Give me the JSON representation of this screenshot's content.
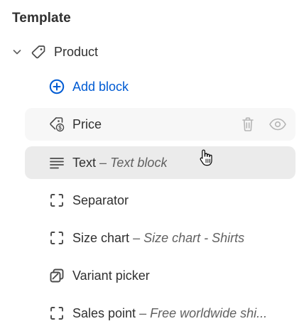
{
  "section": {
    "title": "Template"
  },
  "product": {
    "label": "Product",
    "icon": "tag-icon",
    "expanded": true
  },
  "add_block": {
    "label": "Add block",
    "icon": "plus-circle-icon",
    "color": "#005bd3"
  },
  "blocks": [
    {
      "label": "Price",
      "separator": "",
      "sublabel": "",
      "icon": "price-tag-dollar-icon"
    },
    {
      "label": "Text",
      "separator": "–",
      "sublabel": "Text block",
      "icon": "text-align-icon"
    },
    {
      "label": "Separator",
      "separator": "",
      "sublabel": "",
      "icon": "dashed-square-icon"
    },
    {
      "label": "Size chart",
      "separator": "–",
      "sublabel": "Size chart - Shirts",
      "icon": "dashed-square-icon"
    },
    {
      "label": "Variant picker",
      "separator": "",
      "sublabel": "",
      "icon": "variant-picker-icon"
    },
    {
      "label": "Sales point",
      "separator": "–",
      "sublabel": "Free worldwide shi...",
      "icon": "dashed-square-icon"
    }
  ],
  "colors": {
    "text": "#303030",
    "subtext": "#616161",
    "hover_row": "#f7f7f7",
    "selected_row": "#ebebeb",
    "muted_icon": "#b5b5b5"
  }
}
